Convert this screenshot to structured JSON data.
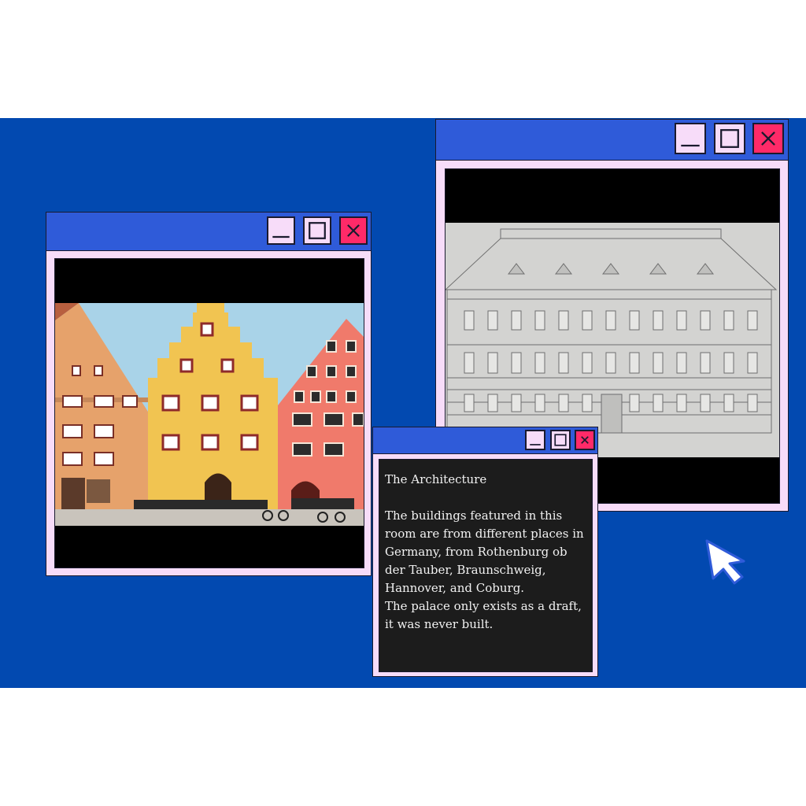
{
  "windows": {
    "left_window": {
      "buttons": [
        "minimize-icon",
        "maximize-icon",
        "close-icon"
      ]
    },
    "right_window": {
      "buttons": [
        "minimize-icon",
        "maximize-icon",
        "close-icon"
      ]
    },
    "text_window": {
      "title": "The Architecture",
      "paragraph1": "The buildings featured in this room are from different places in Germany, from Rothenburg ob der Tauber, Braunschweig, Hannover, and Coburg.",
      "paragraph2": "The palace only exists as a draft, it was never built."
    }
  },
  "colors": {
    "desktop": "#0249b0",
    "titlebar": "#2f5bd9",
    "window_frame": "#f7dcf9",
    "close_button": "#ff2a68"
  }
}
